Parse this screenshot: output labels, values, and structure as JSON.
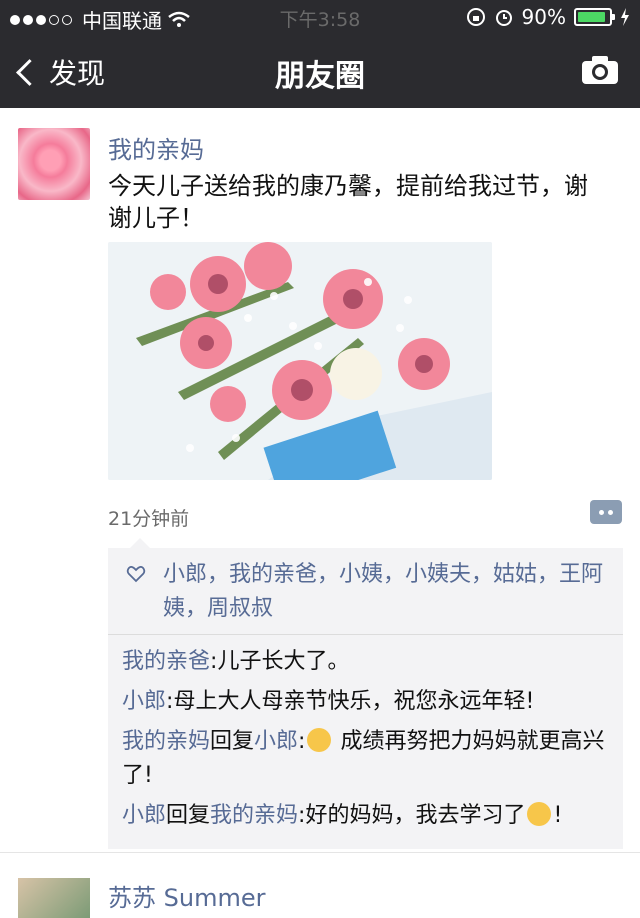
{
  "status_bar": {
    "carrier": "中国联通",
    "time": "下午3:58",
    "battery": "90%",
    "battery_level": 0.9
  },
  "nav": {
    "back_label": "发现",
    "title": "朋友圈",
    "camera_icon": "camera-icon"
  },
  "post": {
    "author": "我的亲妈",
    "text": "今天儿子送给我的康乃馨，提前给我过节，谢谢儿子！",
    "time": "21分钟前",
    "likes": "小郎，我的亲爸，小姨，小姨夫，姑姑，王阿姨，周叔叔",
    "comments": [
      {
        "name": "我的亲爸",
        "sep": ":",
        "text": "儿子长大了。"
      },
      {
        "name": "小郎",
        "sep": ":",
        "text": "母上大人母亲节快乐，祝您永远年轻!"
      },
      {
        "name": "我的亲妈",
        "reply": "回复",
        "to": "小郎",
        "sep": ":",
        "text": " 成绩再努把力妈妈就更高兴了!"
      },
      {
        "name": "小郎",
        "reply": "回复",
        "to": "我的亲妈",
        "sep": ":",
        "text": "好的妈妈，我去学习了",
        "tail": "!"
      }
    ]
  },
  "next_post": {
    "name": "苏苏 Summer"
  },
  "colors": {
    "link": "#576b95",
    "bar": "#2b2b2f"
  }
}
